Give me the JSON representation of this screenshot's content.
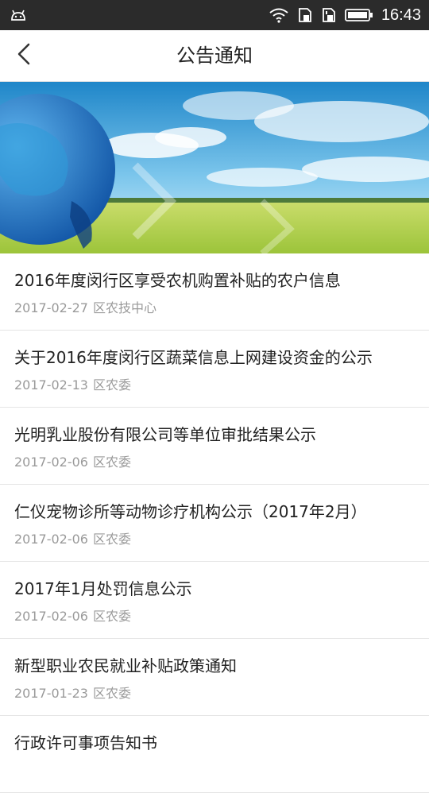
{
  "status_bar": {
    "time": "16:43",
    "icons": [
      "android-icon",
      "wifi-icon",
      "sim1-icon",
      "sim2-icon",
      "battery-icon"
    ]
  },
  "header": {
    "title": "公告通知",
    "back_icon": "chevron-left-icon"
  },
  "banner": {
    "description_icon": "globe-field-banner-image",
    "colors": {
      "sky_top": "#2a8fd0",
      "sky_bottom": "#bfe6f7",
      "field": "#b7d34a",
      "globe": "#1f6fc0"
    }
  },
  "notices": [
    {
      "title": "2016年度闵行区享受农机购置补贴的农户信息",
      "date": "2017-02-27",
      "source": "区农技中心"
    },
    {
      "title": "关于2016年度闵行区蔬菜信息上网建设资金的公示",
      "date": "2017-02-13",
      "source": "区农委"
    },
    {
      "title": "光明乳业股份有限公司等单位审批结果公示",
      "date": "2017-02-06",
      "source": "区农委"
    },
    {
      "title": "仁仪宠物诊所等动物诊疗机构公示（2017年2月）",
      "date": "2017-02-06",
      "source": "区农委"
    },
    {
      "title": "2017年1月处罚信息公示",
      "date": "2017-02-06",
      "source": "区农委"
    },
    {
      "title": "新型职业农民就业补贴政策通知",
      "date": "2017-01-23",
      "source": "区农委"
    },
    {
      "title": "行政许可事项告知书",
      "date": "",
      "source": ""
    }
  ]
}
